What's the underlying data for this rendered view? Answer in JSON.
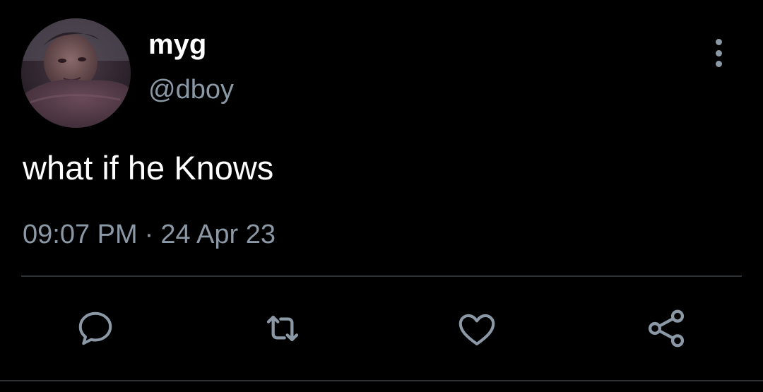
{
  "tweet": {
    "display_name": "myg",
    "handle": "@dboy",
    "text": "what if he Knows",
    "time": "09:07 PM",
    "separator": "·",
    "date": "24 Apr 23"
  },
  "icons": {
    "more": "more-vertical-icon",
    "reply": "reply-icon",
    "retweet": "retweet-icon",
    "like": "heart-icon",
    "share": "share-icon"
  },
  "colors": {
    "background": "#000000",
    "primary_text": "#ffffff",
    "secondary_text": "#8b98a5",
    "divider": "#2f3336"
  }
}
